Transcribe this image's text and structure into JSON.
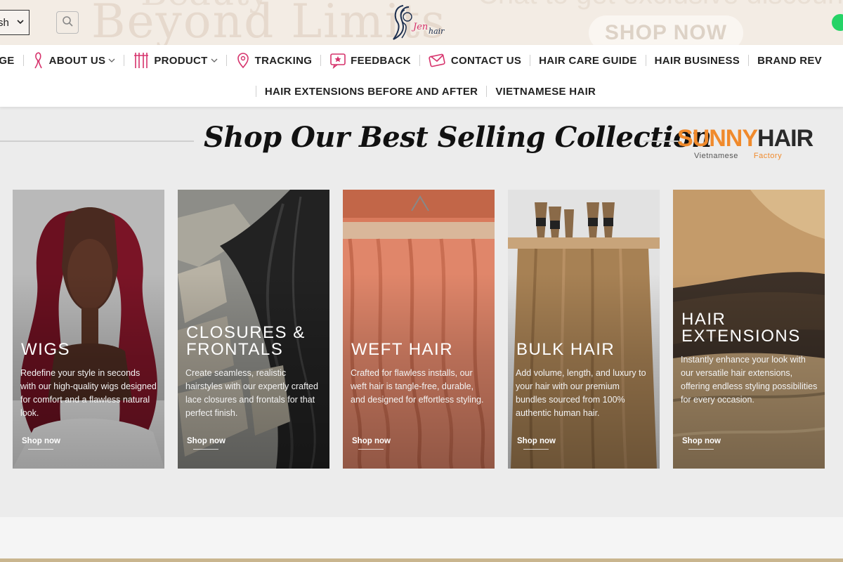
{
  "header": {
    "banner_text_1": "Beyond Limits",
    "banner_text_2": "Beauty",
    "banner_text_right": "Chat to get exclusive discount",
    "banner_button": "SHOP NOW",
    "language_value": "sh",
    "logo_text": "Jen hair"
  },
  "nav": {
    "row1": [
      {
        "label": "PAGE",
        "icon": "",
        "caret": false
      },
      {
        "label": "ABOUT US",
        "icon": "woman-icon",
        "caret": true
      },
      {
        "label": "PRODUCT",
        "icon": "hair-icon",
        "caret": true
      },
      {
        "label": "TRACKING",
        "icon": "location-pin-icon",
        "caret": false
      },
      {
        "label": "FEEDBACK",
        "icon": "star-message-icon",
        "caret": false
      },
      {
        "label": "CONTACT US",
        "icon": "envelope-icon",
        "caret": false
      },
      {
        "label": "HAIR CARE GUIDE",
        "icon": "",
        "caret": false
      },
      {
        "label": "HAIR BUSINESS",
        "icon": "",
        "caret": false
      },
      {
        "label": "BRAND REV",
        "icon": "",
        "caret": false
      }
    ],
    "row2": [
      {
        "label": "HAIR EXTENSIONS BEFORE AND AFTER"
      },
      {
        "label": "VIETNAMESE HAIR"
      }
    ]
  },
  "section": {
    "heading": "Shop Our Best Selling Collection",
    "brand_name_1": "SUNNY",
    "brand_name_2": "HAIR",
    "brand_sub_1": "Vietnamese",
    "brand_sub_2": "Factory"
  },
  "cards": [
    {
      "title": "WIGS",
      "desc": "Redefine your style in seconds with our high-quality wigs designed for comfort and a flawless natural look.",
      "cta": "Shop now"
    },
    {
      "title": "CLOSURES & FRONTALS",
      "desc": "Create seamless, realistic hairstyles with our expertly crafted lace closures and frontals for that perfect finish.",
      "cta": "Shop now"
    },
    {
      "title": "WEFT HAIR",
      "desc": "Crafted for flawless installs, our weft hair is tangle-free, durable, and designed for effortless styling.",
      "cta": "Shop now"
    },
    {
      "title": "BULK HAIR",
      "desc": "Add volume, length, and luxury to your hair with our premium bundles sourced from 100% authentic human hair.",
      "cta": "Shop now"
    },
    {
      "title": "HAIR EXTENSIONS",
      "desc": "Instantly enhance your look with our versatile hair extensions, offering endless styling possibilities for every occasion.",
      "cta": "Shop now"
    }
  ],
  "colors": {
    "accent": "#f08a2c",
    "nav_text": "#222222",
    "icon_pink": "#d6336c"
  }
}
